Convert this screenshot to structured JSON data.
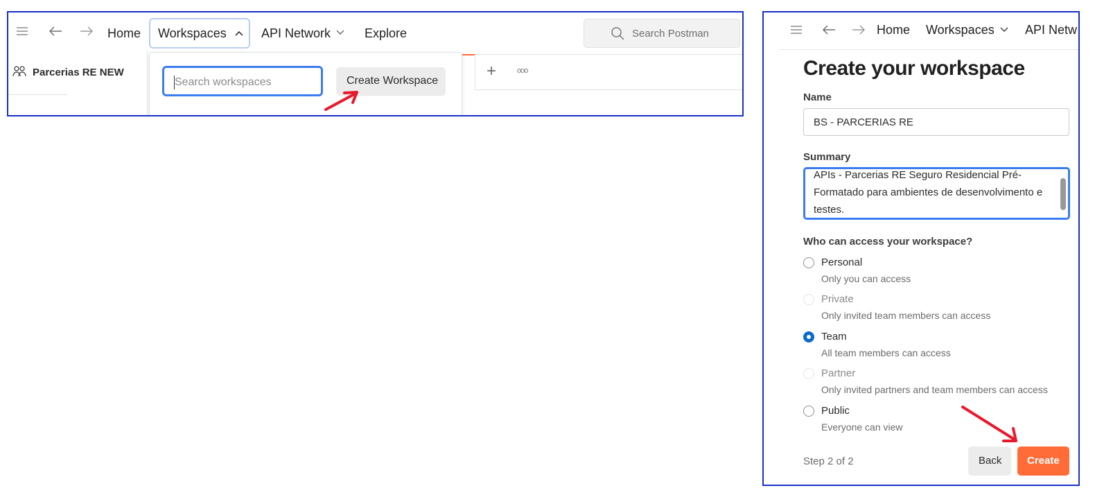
{
  "left": {
    "nav": {
      "home": "Home",
      "workspaces": "Workspaces",
      "api_network": "API Network",
      "explore": "Explore",
      "search_placeholder": "Search Postman"
    },
    "sidebar": {
      "workspace_name": "Parcerias RE NEW"
    },
    "dropdown": {
      "search_placeholder": "Search workspaces",
      "create_button": "Create Workspace"
    },
    "tabs": {
      "add": "+",
      "more": "ooo"
    }
  },
  "right": {
    "nav": {
      "home": "Home",
      "workspaces": "Workspaces",
      "api_network": "API Netw"
    },
    "form": {
      "title": "Create your workspace",
      "name_label": "Name",
      "name_value": "BS - PARCERIAS RE",
      "summary_label": "Summary",
      "summary_lines": [
        "APIs - Parcerias RE Seguro Residencial Pré-",
        "Formatado para ambientes de desenvolvimento e",
        "testes."
      ],
      "access_label": "Who can access your workspace?",
      "options": [
        {
          "title": "Personal",
          "desc": "Only you can access",
          "state": "enabled"
        },
        {
          "title": "Private",
          "desc": "Only invited team members can access",
          "state": "disabled"
        },
        {
          "title": "Team",
          "desc": "All team members can access",
          "state": "selected"
        },
        {
          "title": "Partner",
          "desc": "Only invited partners and team members can access",
          "state": "disabled"
        },
        {
          "title": "Public",
          "desc": "Everyone can view",
          "state": "enabled"
        }
      ],
      "step_text": "Step 2 of 2",
      "back_button": "Back",
      "create_button": "Create"
    }
  },
  "colors": {
    "frame_border": "#1a2fc7",
    "accent_orange": "#ff6c37",
    "radio_selected": "#0b6bcb",
    "focus_blue": "#3b7cf0",
    "annotation_arrow": "#e8192c"
  },
  "icons": [
    "menu-icon",
    "back-arrow-icon",
    "forward-arrow-icon",
    "chevron-up-icon",
    "chevron-down-icon",
    "search-icon",
    "team-icon",
    "plus-icon",
    "more-icon",
    "annotation-arrow"
  ]
}
